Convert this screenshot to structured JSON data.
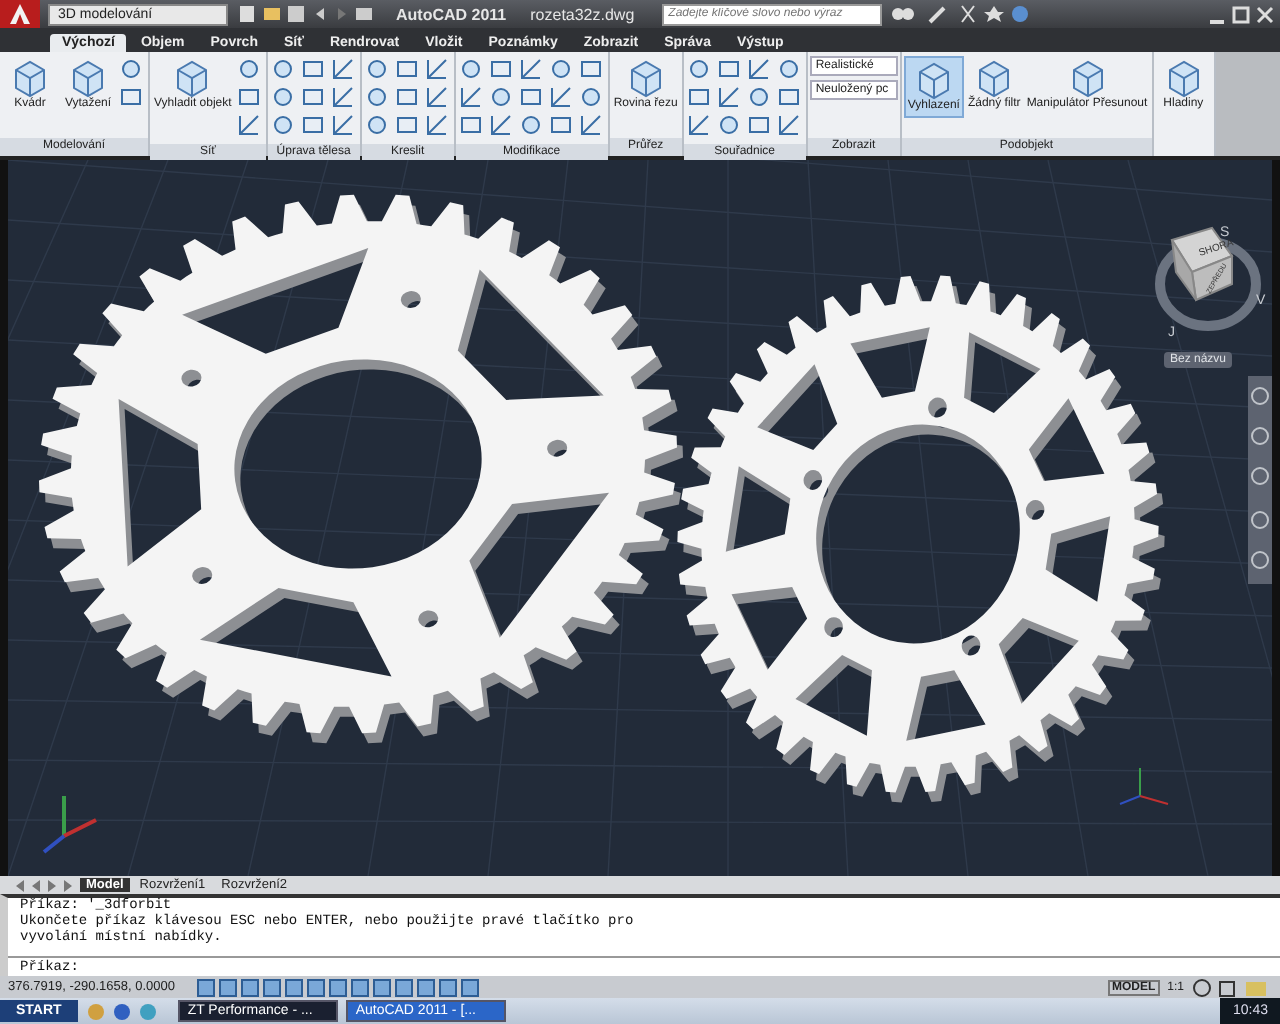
{
  "title_bar": {
    "workspace": "3D modelování",
    "app_title": "AutoCAD 2011",
    "file_name": "rozeta32z.dwg",
    "search_placeholder": "Zadejte klíčové slovo nebo výraz"
  },
  "ribbon_tabs": [
    {
      "label": "Výchozí",
      "selected": true
    },
    {
      "label": "Objem",
      "selected": false
    },
    {
      "label": "Povrch",
      "selected": false
    },
    {
      "label": "Síť",
      "selected": false
    },
    {
      "label": "Rendrovat",
      "selected": false
    },
    {
      "label": "Vložit",
      "selected": false
    },
    {
      "label": "Poznámky",
      "selected": false
    },
    {
      "label": "Zobrazit",
      "selected": false
    },
    {
      "label": "Správa",
      "selected": false
    },
    {
      "label": "Výstup",
      "selected": false
    }
  ],
  "ribbon_panels": [
    {
      "title": "Modelování",
      "large_buttons": [
        {
          "label": "Kvádr",
          "selected": false
        },
        {
          "label": "Vytažení",
          "selected": false
        }
      ]
    },
    {
      "title": "Síť",
      "large_buttons": [
        {
          "label": "Vyhladit objekt",
          "selected": false
        }
      ]
    },
    {
      "title": "Úprava tělesa"
    },
    {
      "title": "Kreslit"
    },
    {
      "title": "Modifikace"
    },
    {
      "title": "Průřez",
      "large_buttons": [
        {
          "label": "Rovina řezu",
          "selected": false
        }
      ]
    },
    {
      "title": "Souřadnice"
    },
    {
      "title": "Zobrazit",
      "dropdowns": [
        "Realistické",
        "Neuložený pc"
      ]
    },
    {
      "title": "Podobjekt",
      "large_buttons": [
        {
          "label": "Vyhlazení",
          "selected": true
        },
        {
          "label": "Žádný filtr",
          "selected": false
        },
        {
          "label": "Manipulátor Přesunout",
          "selected": false
        }
      ]
    },
    {
      "large_buttons": [
        {
          "label": "Hladiny",
          "selected": false
        }
      ]
    }
  ],
  "viewcube": {
    "top_face": "SHORA",
    "side_face": "ZEPŘEDU",
    "compass": [
      "S",
      "V",
      "J"
    ],
    "ucs_menu": "Bez názvu"
  },
  "layout_tabs": [
    {
      "label": "Model",
      "selected": true
    },
    {
      "label": "Rozvržení1",
      "selected": false
    },
    {
      "label": "Rozvržení2",
      "selected": false
    }
  ],
  "command_history": [
    "Příkaz: '_3dforbit",
    "Ukončete příkaz klávesou ESC nebo ENTER, nebo použijte pravé tlačítko pro",
    "vyvolání místní nabídky."
  ],
  "command_prompt": "Příkaz:",
  "status_bar": {
    "coordinates": "376.7919, -290.1658, 0.0000",
    "space": "MODEL",
    "scale": "1:1"
  },
  "taskbar": {
    "start": "START",
    "windows": [
      {
        "label": "ZT Performance - ...",
        "selected": false
      },
      {
        "label": "AutoCAD 2011 - [...",
        "selected": true
      }
    ],
    "clock": "10:43"
  }
}
